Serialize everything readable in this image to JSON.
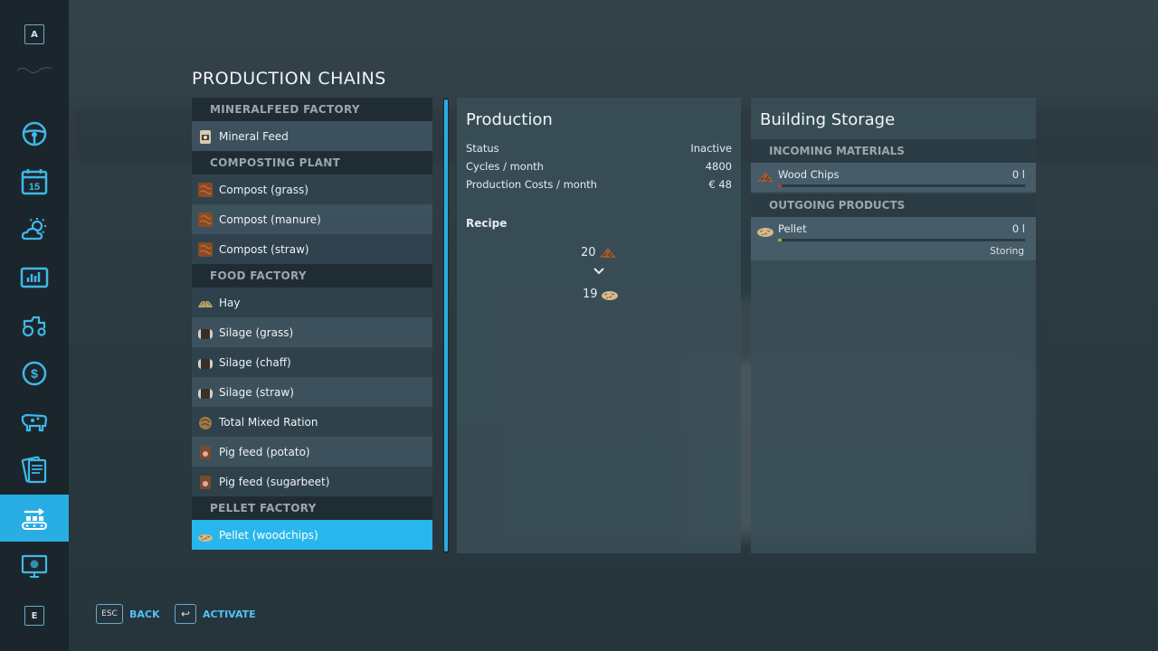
{
  "sidebar": {
    "top_key": "A",
    "bottom_key": "E",
    "items": [
      {
        "icon": "steering-wheel-icon"
      },
      {
        "icon": "calendar-icon",
        "text": "15"
      },
      {
        "icon": "weather-icon"
      },
      {
        "icon": "statistics-icon"
      },
      {
        "icon": "tractor-icon"
      },
      {
        "icon": "finances-icon"
      },
      {
        "icon": "animals-icon"
      },
      {
        "icon": "contracts-icon"
      },
      {
        "icon": "production-icon",
        "active": true
      },
      {
        "icon": "help-icon"
      }
    ]
  },
  "page_title": "PRODUCTION CHAINS",
  "chains": {
    "mineralfeed": {
      "header": "MINERALFEED FACTORY",
      "items": [
        "Mineral Feed"
      ]
    },
    "composting": {
      "header": "COMPOSTING PLANT",
      "items": [
        "Compost (grass)",
        "Compost (manure)",
        "Compost (straw)"
      ]
    },
    "food": {
      "header": "FOOD FACTORY",
      "items": [
        "Hay",
        "Silage (grass)",
        "Silage (chaff)",
        "Silage (straw)",
        "Total Mixed Ration",
        "Pig feed (potato)",
        "Pig feed (sugarbeet)"
      ]
    },
    "pellet": {
      "header": "PELLET FACTORY",
      "items": [
        "Pellet (woodchips)"
      ]
    }
  },
  "production": {
    "title": "Production",
    "status_label": "Status",
    "status_value": "Inactive",
    "cycles_label": "Cycles / month",
    "cycles_value": "4800",
    "costs_label": "Production Costs / month",
    "costs_value": "€ 48",
    "recipe_label": "Recipe",
    "recipe_input_amount": "20",
    "recipe_output_amount": "19"
  },
  "storage": {
    "title": "Building Storage",
    "incoming_header": "INCOMING MATERIALS",
    "incoming": {
      "name": "Wood Chips",
      "amount": "0 l",
      "fill_color": "#c0392b"
    },
    "outgoing_header": "OUTGOING PRODUCTS",
    "outgoing": {
      "name": "Pellet",
      "amount": "0 l",
      "mode": "Storing",
      "fill_color": "#7bc043"
    }
  },
  "hints": {
    "back_key": "ESC",
    "back_label": "BACK",
    "activate_key": "↩",
    "activate_label": "ACTIVATE"
  },
  "colors": {
    "accent": "#29aee4"
  }
}
